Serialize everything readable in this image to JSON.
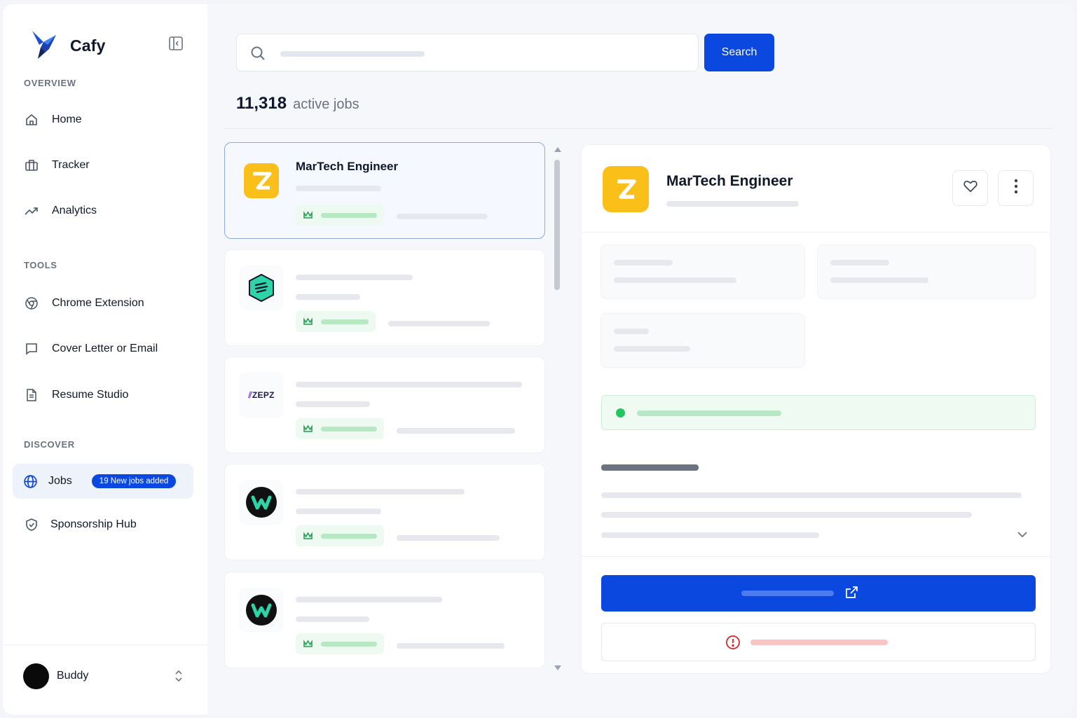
{
  "app": {
    "name": "Cafy"
  },
  "sidebar": {
    "sections": {
      "overview": "OVERVIEW",
      "tools": "TOOLS",
      "discover": "DISCOVER"
    },
    "items": [
      {
        "label": "Home",
        "icon": "home-icon"
      },
      {
        "label": "Tracker",
        "icon": "briefcase-icon"
      },
      {
        "label": "Analytics",
        "icon": "trending-up-icon"
      },
      {
        "label": "Chrome Extension",
        "icon": "chrome-icon"
      },
      {
        "label": "Cover Letter or Email",
        "icon": "message-square-icon"
      },
      {
        "label": "Resume Studio",
        "icon": "file-text-icon"
      },
      {
        "label": "Jobs",
        "icon": "globe-icon",
        "badge": "19 New jobs added",
        "active": true
      },
      {
        "label": "Sponsorship Hub",
        "icon": "shield-check-icon"
      }
    ],
    "user": {
      "name": "Buddy"
    }
  },
  "search": {
    "button_label": "Search"
  },
  "jobs": {
    "count": "11,318",
    "count_label": "active jobs",
    "list": [
      {
        "title": "MarTech Engineer",
        "logo": "zinc-logo",
        "selected": true
      },
      {
        "title": "",
        "logo": "hexagon-logo"
      },
      {
        "title": "",
        "logo": "zepz-logo",
        "logo_text": "ZEPZ"
      },
      {
        "title": "",
        "logo": "w-logo"
      },
      {
        "title": "",
        "logo": "w-logo"
      }
    ]
  },
  "detail": {
    "title": "MarTech Engineer",
    "logo": "zinc-logo"
  },
  "colors": {
    "accent": "#0b48e0",
    "logo_yellow": "#fbbf1a",
    "success": "#22c55e",
    "danger": "#dc2626"
  }
}
